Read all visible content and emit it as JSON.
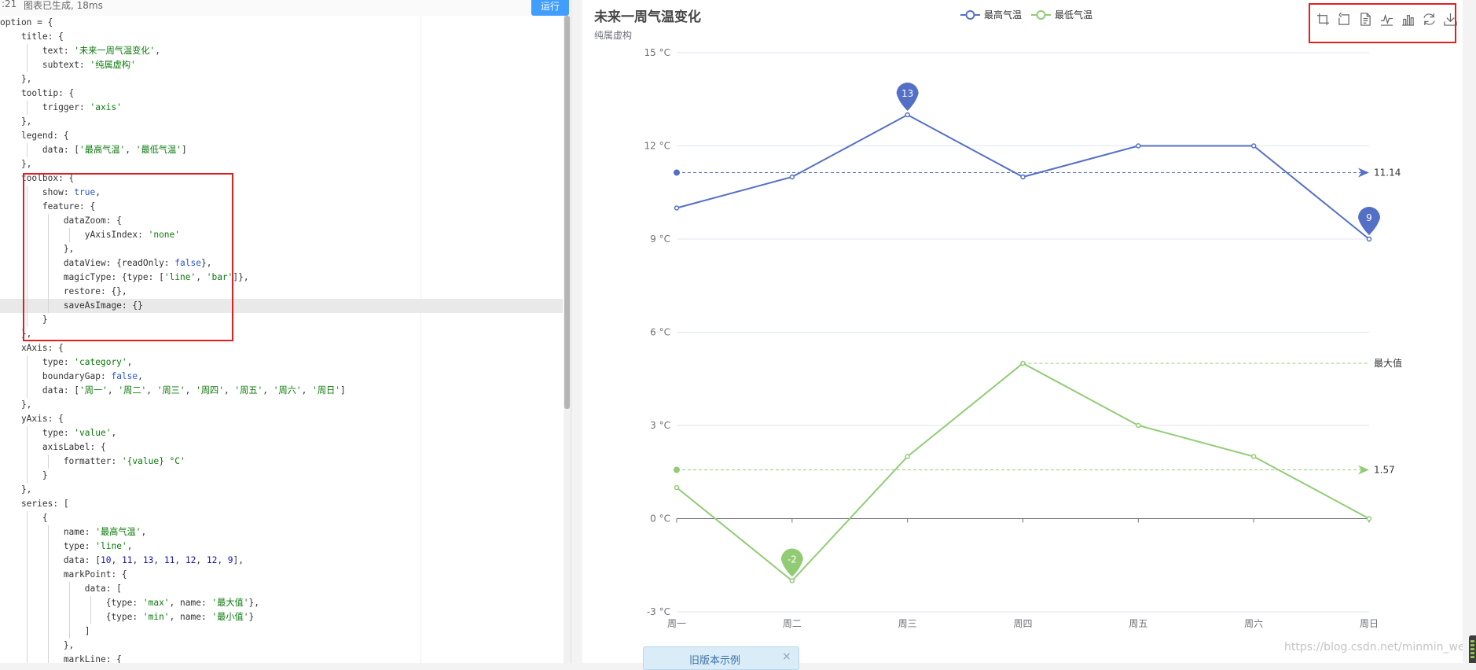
{
  "editor": {
    "status_left": ":21",
    "status_text": "图表已生成, 18ms",
    "run_label": "运行"
  },
  "chart_data": {
    "type": "line",
    "title": "未来一周气温变化",
    "subtitle": "纯属虚构",
    "categories": [
      "周一",
      "周二",
      "周三",
      "周四",
      "周五",
      "周六",
      "周日"
    ],
    "series": [
      {
        "name": "最高气温",
        "values": [
          10,
          11,
          13,
          11,
          12,
          12,
          9
        ],
        "color": "#5470c6"
      },
      {
        "name": "最低气温",
        "values": [
          1,
          -2,
          2,
          5,
          3,
          2,
          0
        ],
        "color": "#91cc75"
      }
    ],
    "y_ticks": [
      "15 °C",
      "12 °C",
      "9 °C",
      "6 °C",
      "3 °C",
      "0 °C",
      "-3 °C"
    ],
    "ylim": [
      -3,
      15
    ],
    "mark_points": [
      {
        "series": 0,
        "index": 2,
        "value": 13,
        "label": "13"
      },
      {
        "series": 0,
        "index": 6,
        "value": 9,
        "label": "9"
      },
      {
        "series": 1,
        "index": 1,
        "value": -2,
        "label": "-2"
      }
    ],
    "mark_lines": [
      {
        "series": 0,
        "value": 11.14,
        "start_index": 0,
        "label": "11.14",
        "arrow": true
      },
      {
        "series": 1,
        "value": 1.57,
        "start_index": 0,
        "label": "1.57",
        "arrow": true
      },
      {
        "series": 1,
        "value": 5,
        "start_index": 3,
        "label": "最大值",
        "arrow": false
      }
    ],
    "legend_position": "top-center",
    "grid": "horizontal"
  },
  "toolbox": [
    "zoom-icon",
    "zoom-reset-icon",
    "data-view-icon",
    "line-chart-icon",
    "bar-chart-icon",
    "restore-icon",
    "save-image-icon"
  ],
  "old_example": {
    "label": "旧版本示例",
    "close": "×"
  },
  "watermark": "https://blog.csdn.net/minmin_wei"
}
